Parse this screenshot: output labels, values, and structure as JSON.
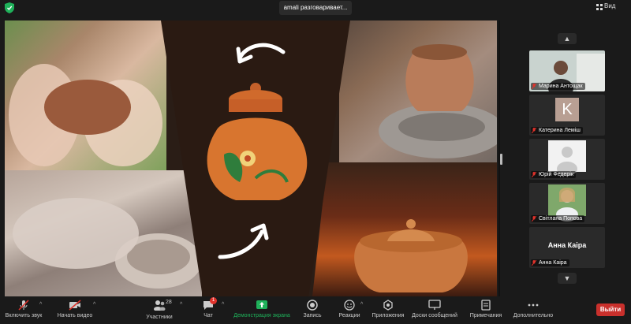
{
  "top": {
    "speaker": "amali разговаривает...",
    "view_label": "Вид"
  },
  "colors": {
    "leave": "#c9302c",
    "share_accent": "#1fb15a",
    "background": "#1a1a1a"
  },
  "gallery": {
    "up_icon": "chevron-up-icon",
    "down_icon": "chevron-down-icon",
    "participants": [
      {
        "name": "Марина Антощак",
        "type": "video"
      },
      {
        "name": "Катерина Леміш",
        "type": "avatar",
        "initial": "K"
      },
      {
        "name": "Юрій Федерік",
        "type": "video"
      },
      {
        "name": "Світлана Попова",
        "type": "video"
      },
      {
        "name": "Анна Каіра",
        "type": "name",
        "display": "Анна Каіра"
      }
    ]
  },
  "toolbar": {
    "unmute": "Включить звук",
    "start_video": "Начать видео",
    "participants_label": "Участники",
    "participants_count": "28",
    "chat": "Чат",
    "chat_badge": "1",
    "share": "Демонстрация экрана",
    "record": "Запись",
    "reactions": "Реакции",
    "apps": "Приложения",
    "whiteboards": "Доски сообщений",
    "notes": "Примечания",
    "more": "Дополнительно",
    "leave": "Выйти"
  }
}
